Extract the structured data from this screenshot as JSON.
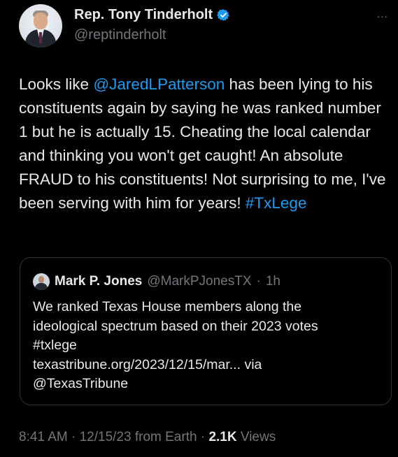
{
  "author": {
    "display_name": "Rep. Tony Tinderholt",
    "handle": "@reptinderholt",
    "verified": true,
    "avatar_icon": "profile-photo",
    "more_label": "..."
  },
  "tweet": {
    "text_before_mention": "Looks like ",
    "mention": "@JaredLPatterson",
    "text_after_mention": " has been lying to his constituents again by saying he was ranked number 1 but he is actually 15. Cheating the local calendar and thinking you won't get caught! An absolute FRAUD to his constituents! Not surprising to me, I've been serving with him for years! ",
    "hashtag": "#TxLege"
  },
  "quoted_tweet": {
    "display_name": "Mark P. Jones",
    "handle": "@MarkPJonesTX",
    "separator": "·",
    "time": "1h",
    "lines": [
      "We ranked Texas House members along the",
      "ideological spectrum based on their 2023 votes",
      "#txlege",
      "texastribune.org/2023/12/15/mar... via",
      "@TexasTribune"
    ]
  },
  "meta": {
    "time": "8:41 AM",
    "sep1": "·",
    "date": "12/15/23",
    "source": "from Earth",
    "sep2": "·",
    "views_count": "2.1K",
    "views_label": "Views"
  },
  "colors": {
    "background": "#000000",
    "text": "#e7e9ea",
    "muted": "#71767b",
    "accent": "#1d9bf0",
    "border": "#2f3336"
  }
}
